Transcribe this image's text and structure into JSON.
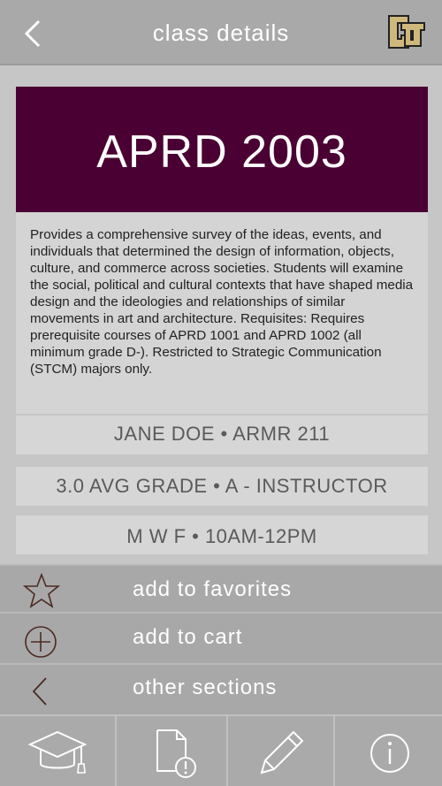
{
  "header": {
    "title": "class details"
  },
  "course": {
    "code": "APRD 2003",
    "description": "Provides a comprehensive survey of the ideas, events, and individuals that determined the design of infor­mation, objects, culture, and commerce across societ­ies. Students will examine the social, political and cul­tural contexts that have shaped media design and the ideologies and relationships of similar movements in art and architecture. Requisites: Requires prerequisite courses of APRD 1001 and APRD 1002 (all minimum grade D-). Restricted to Strategic Communication (STCM) majors only.",
    "instructor_room": "JANE DOE • ARMR 211",
    "grade_info": "3.0 AVG GRADE • A - INSTRUCTOR",
    "schedule": "M W F • 10AM-12PM"
  },
  "actions": {
    "favorites_label": "add to favorites",
    "cart_label": "add to cart",
    "sections_label": "other sections"
  },
  "tabs": [
    "graduation-cap-icon",
    "document-alert-icon",
    "pencil-icon",
    "info-icon"
  ],
  "colors": {
    "brand": "#4a0033",
    "header": "#a9a9a9",
    "gold": "#cfb87c"
  }
}
